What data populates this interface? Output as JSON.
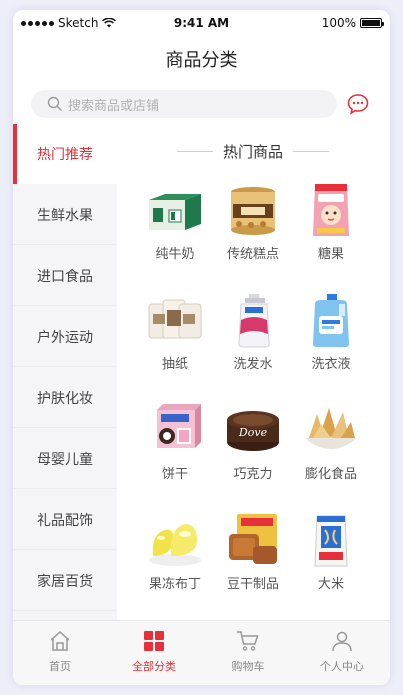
{
  "status_bar": {
    "carrier": "Sketch",
    "time": "9:41 AM",
    "battery": "100%"
  },
  "header": {
    "title": "商品分类"
  },
  "search": {
    "placeholder": "搜索商品或店铺",
    "icon": "search-icon",
    "message_icon": "message-icon"
  },
  "sidebar": {
    "items": [
      {
        "label": "热门推荐",
        "active": true
      },
      {
        "label": "生鲜水果",
        "active": false
      },
      {
        "label": "进口食品",
        "active": false
      },
      {
        "label": "户外运动",
        "active": false
      },
      {
        "label": "护肤化妆",
        "active": false
      },
      {
        "label": "母婴儿童",
        "active": false
      },
      {
        "label": "礼品配饰",
        "active": false
      },
      {
        "label": "家居百货",
        "active": false
      }
    ]
  },
  "section": {
    "title": "热门商品"
  },
  "products": [
    {
      "name": "纯牛奶",
      "icon": "milk-box-icon"
    },
    {
      "name": "传统糕点",
      "icon": "pastry-jar-icon"
    },
    {
      "name": "糖果",
      "icon": "candy-bag-icon"
    },
    {
      "name": "抽纸",
      "icon": "tissue-pack-icon"
    },
    {
      "name": "洗发水",
      "icon": "shampoo-bottle-icon"
    },
    {
      "name": "洗衣液",
      "icon": "detergent-bottle-icon"
    },
    {
      "name": "饼干",
      "icon": "biscuit-box-icon"
    },
    {
      "name": "巧克力",
      "icon": "chocolate-box-icon"
    },
    {
      "name": "膨化食品",
      "icon": "chips-bowl-icon"
    },
    {
      "name": "果冻布丁",
      "icon": "jelly-icon"
    },
    {
      "name": "豆干制品",
      "icon": "tofu-snack-icon"
    },
    {
      "name": "大米",
      "icon": "rice-bag-icon"
    }
  ],
  "bottom_nav": {
    "items": [
      {
        "label": "首页",
        "icon": "home-icon",
        "active": false
      },
      {
        "label": "全部分类",
        "icon": "grid-icon",
        "active": true
      },
      {
        "label": "购物车",
        "icon": "cart-icon",
        "active": false
      },
      {
        "label": "个人中心",
        "icon": "user-icon",
        "active": false
      }
    ]
  },
  "colors": {
    "accent": "#e8303a",
    "sidebar_bg": "#f5f5f7",
    "search_bg": "#f3f3f5"
  }
}
